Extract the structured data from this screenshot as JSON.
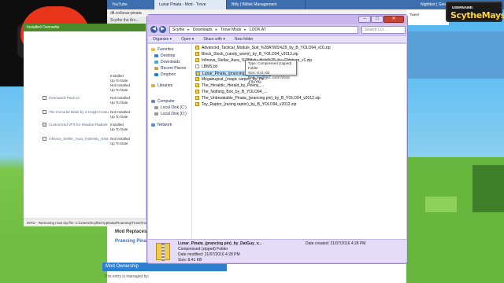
{
  "browser": {
    "tabs": [
      {
        "label": "YouTube"
      },
      {
        "label": "Lunar Pinata - Mod - Trove"
      },
      {
        "label": "Bitly | Bitlink Management"
      },
      {
        "label": "Nightbot | Giveaway"
      }
    ],
    "address": "dfl.co/lunar-pinata",
    "bookmarks": "Scythe the Arc..."
  },
  "mod_manager": {
    "header": "Installed Overwrite",
    "items": [
      {
        "name": "Overwatch Pack v2",
        "status_line1": "Not Installed",
        "status_line2": "Up To Date",
        "checked": false
      },
      {
        "name": "The Immortal Mask by S Knight Costume",
        "status_line1": "Not Installed",
        "status_line2": "Up To Date",
        "checked": false
      },
      {
        "name": "Customized VFX for Shadow Radiant Ski",
        "status_line1": "Installed",
        "status_line2": "Up To Date",
        "checked": true
      },
      {
        "name": "Infinova_Stellar_Aura_%28Holy_Halo%29",
        "status_line1": "Not Installed",
        "status_line2": "Up To Date",
        "checked": false
      }
    ],
    "status_top": [
      {
        "line1": "Installed",
        "line2": "Up To Date"
      },
      {
        "line1": "Not Installed",
        "line2": "Up To Date"
      }
    ],
    "info": "INFO - Removing mod zip file: C:/Users/Scythe/AppData/Roaming/Trove/mods/M"
  },
  "page": {
    "mod_replaces": "Mod Replaces:",
    "prancing": "Prancing Pinata",
    "mod_ownership": "Mod Ownership",
    "managed_by": "This entry is managed by:",
    "twitter": "Tweet"
  },
  "badge": {
    "label": "USERNAME:",
    "name": "ScytheMays"
  },
  "explorer": {
    "breadcrumb": [
      "Scythe",
      "Downloads",
      "Trove Mods",
      "LOOK AT"
    ],
    "search_placeholder": "Search LO...",
    "toolbar": [
      "Organize ▾",
      "Open ▾",
      "Share with ▾",
      "New folder"
    ],
    "nav": {
      "favorites": "Favorites",
      "desktop": "Desktop",
      "downloads": "Downloads",
      "recent": "Recent Places",
      "dropbox": "Dropbox",
      "libraries": "Libraries",
      "computer": "Computer",
      "local_c": "Local Disk (C:)",
      "local_d": "Local Disk (D:)",
      "network": "Network"
    },
    "files": [
      "Advanced_Tactical_Module_Suit_%28ATMS%29_by_B_YOLO94_v10.zip",
      "Block_Stock_(candy_worm)_by_B_YOLO94_v2013.zip",
      "Infinova_Stellar_Aura_%28Holy_Halo%29_by_Glitchum_v1.zip",
      "LBMS.txt",
      "Lunar_Pinata_(prancing_pin)_by_DatGuy_v3.0.zip",
      "Megabugcat_(magic carpet)_by_Pe...",
      "The_Heraldic_Herald_by_Peeny_...",
      "The_Nothing_Box_by_B_YOLO94_...",
      "The_Unbreakable_Pinata_(prancing pin)_by_B_YOLO94_v2012.zip",
      "Toy_Raptor_(racing raptor)_by_B_YOLO94_v2012.zip"
    ],
    "tooltip": {
      "type": "Type: Compressed (zipped) Folder",
      "size": "Size: 8.41 KB",
      "modified": "Date modified: 21/07/2016 4:28 PM"
    },
    "details": {
      "filename": "Lunar_Pinata_(prancing pin)_by_DatGuy_v...",
      "date_created": "Date created: 21/07/2016 4:28 PM",
      "type": "Compressed (zipped) Folder",
      "date_modified": "Date modified: 21/07/2016 4:28 PM",
      "size": "Size: 8.41 KB"
    }
  },
  "colors": {
    "accent": "#c8b6ea",
    "close": "#c64335",
    "highlight": "#cce4fb"
  }
}
